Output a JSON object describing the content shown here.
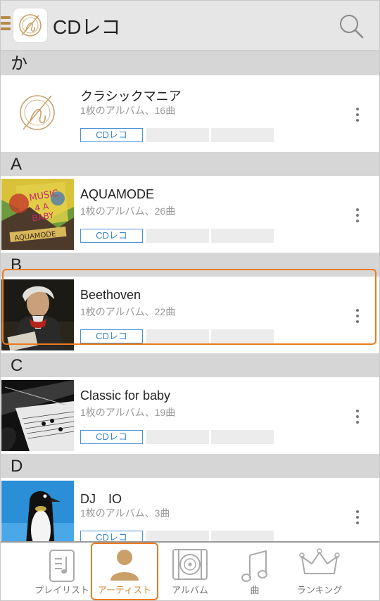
{
  "header": {
    "app_title": "CDレコ",
    "menu_icon": "hamburger-icon",
    "logo_icon": "cdreco-logo-icon",
    "search_icon": "search-icon"
  },
  "sections": [
    {
      "letter": "か",
      "artists": [
        {
          "name": "クラシックマニア",
          "meta": "1枚のアルバム、16曲",
          "tag": "CDレコ",
          "thumb": "cdreco-logo"
        }
      ]
    },
    {
      "letter": "A",
      "artists": [
        {
          "name": "AQUAMODE",
          "meta": "1枚のアルバム、26曲",
          "tag": "CDレコ",
          "thumb": "colorful-poster"
        }
      ]
    },
    {
      "letter": "B",
      "artists": [
        {
          "name": "Beethoven",
          "meta": "1枚のアルバム、22曲",
          "tag": "CDレコ",
          "thumb": "portrait"
        }
      ]
    },
    {
      "letter": "C",
      "artists": [
        {
          "name": "Classic for baby",
          "meta": "1枚のアルバム、19曲",
          "tag": "CDレコ",
          "thumb": "violin-photo"
        }
      ]
    },
    {
      "letter": "D",
      "artists": [
        {
          "name": "DJ　IO",
          "meta": "1枚のアルバム、3曲",
          "tag": "CDレコ",
          "thumb": "penguin"
        }
      ]
    }
  ],
  "bottom_nav": [
    {
      "label": "プレイリスト",
      "icon": "playlist-icon",
      "active": false
    },
    {
      "label": "アーティスト",
      "icon": "artist-icon",
      "active": true
    },
    {
      "label": "アルバム",
      "icon": "album-icon",
      "active": false
    },
    {
      "label": "曲",
      "icon": "music-note-icon",
      "active": false
    },
    {
      "label": "ランキング",
      "icon": "crown-icon",
      "active": false
    }
  ],
  "colors": {
    "accent": "#ee7a1c",
    "brand": "#b58a4c",
    "tag_blue": "#3a86d2",
    "section_bg": "#d6d6d6",
    "header_bg": "#e6e6e6"
  }
}
